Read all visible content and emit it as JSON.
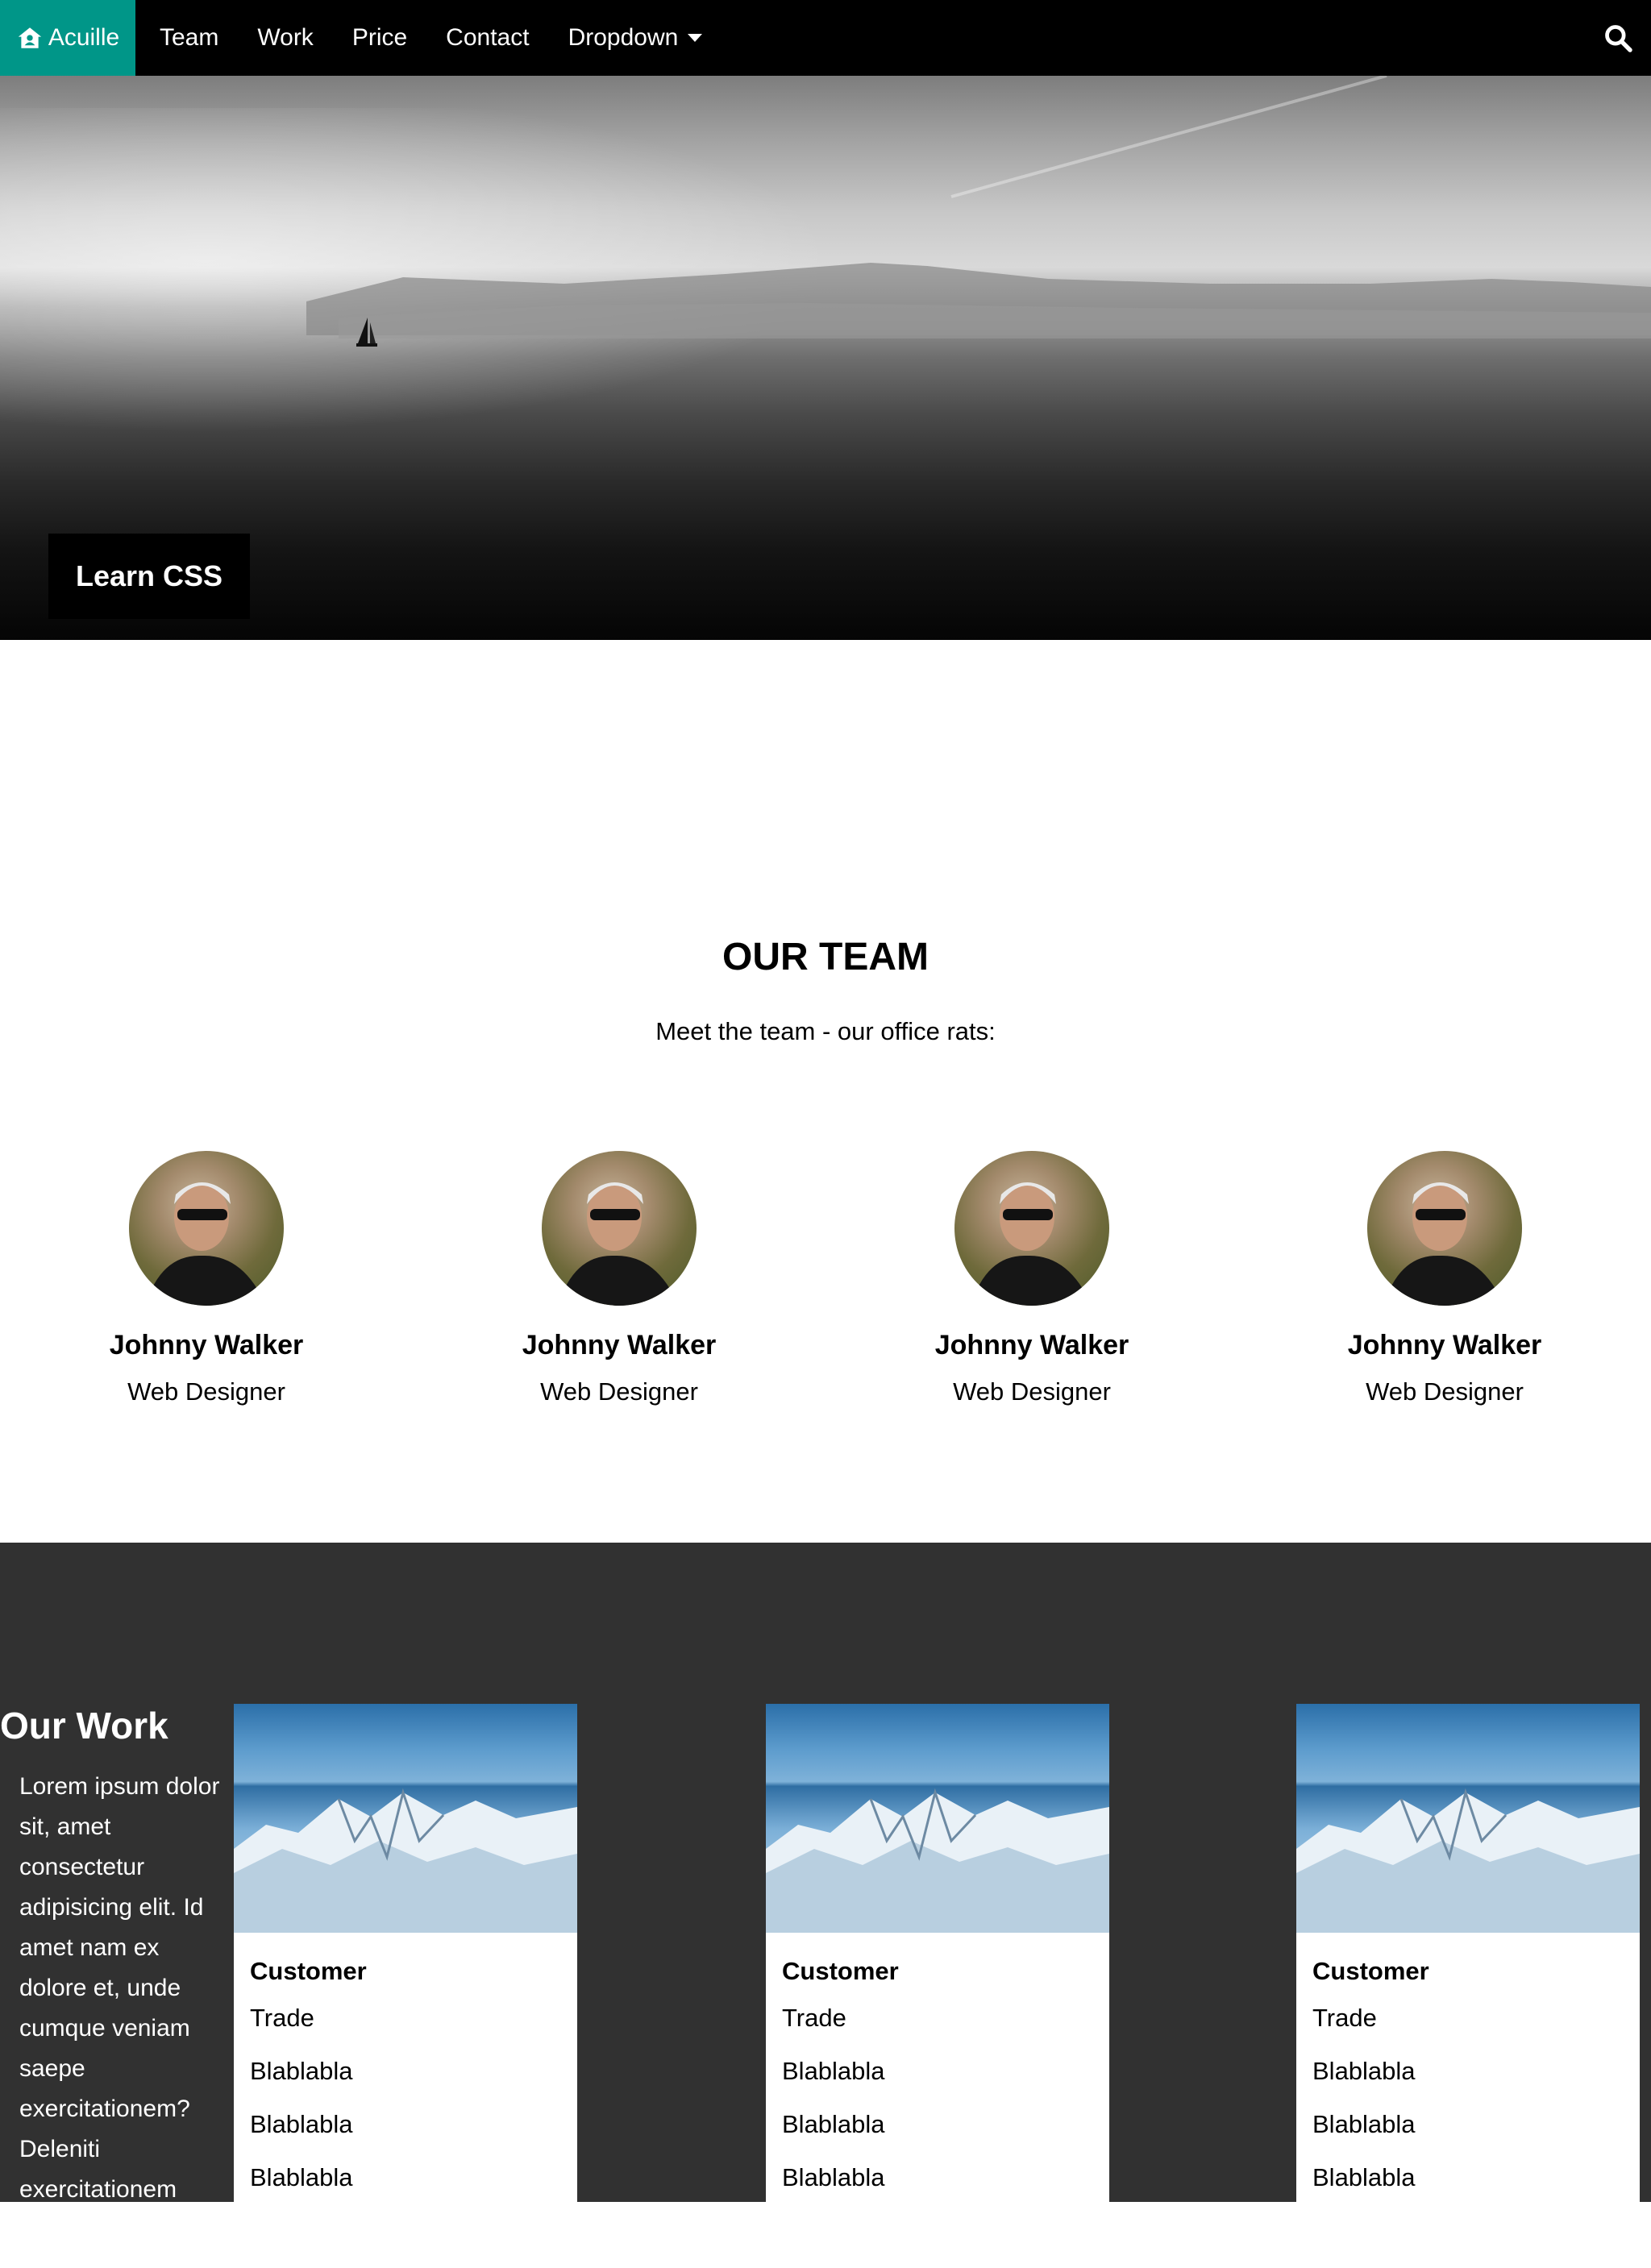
{
  "nav": {
    "brand": "Acuille",
    "items": [
      "Team",
      "Work",
      "Price",
      "Contact"
    ],
    "dropdown": "Dropdown",
    "brand_color": "#009688"
  },
  "hero": {
    "button": "Learn CSS"
  },
  "team": {
    "title": "OUR TEAM",
    "subtitle": "Meet the team - our office rats:",
    "members": [
      {
        "name": "Johnny Walker",
        "role": "Web Designer"
      },
      {
        "name": "Johnny Walker",
        "role": "Web Designer"
      },
      {
        "name": "Johnny Walker",
        "role": "Web Designer"
      },
      {
        "name": "Johnny Walker",
        "role": "Web Designer"
      }
    ]
  },
  "work": {
    "title": "Our Work",
    "text": "Lorem ipsum dolor sit, amet consectetur adipisicing elit. Id amet nam ex dolore et, unde cumque veniam saepe exercitationem? Deleniti exercitationem",
    "cards": [
      {
        "title": "Customer",
        "lines": [
          "Trade",
          "Blablabla",
          "Blablabla",
          "Blablabla"
        ]
      },
      {
        "title": "Customer",
        "lines": [
          "Trade",
          "Blablabla",
          "Blablabla",
          "Blablabla"
        ]
      },
      {
        "title": "Customer",
        "lines": [
          "Trade",
          "Blablabla",
          "Blablabla",
          "Blablabla"
        ]
      }
    ]
  }
}
